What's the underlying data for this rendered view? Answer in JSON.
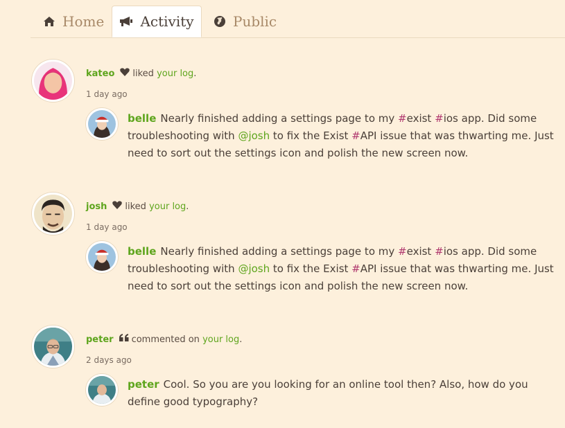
{
  "tabs": [
    {
      "label": "Home",
      "icon": "home-icon"
    },
    {
      "label": "Activity",
      "icon": "megaphone-icon"
    },
    {
      "label": "Public",
      "icon": "globe-icon"
    }
  ],
  "colors": {
    "accent_green": "#5ea51d",
    "hashtag": "#b0376e",
    "background": "#fdf0dc"
  },
  "feed": [
    {
      "user": "kateo",
      "action_icon": "heart-icon",
      "action": "liked",
      "link": "your log",
      "period": ".",
      "time": "1 day ago",
      "log": {
        "author": "belle",
        "p1": "Nearly finished adding a settings page to my ",
        "h1": "#",
        "t1": "exist",
        "s1": " ",
        "h2": "#",
        "t2": "ios",
        "p2": " app. Did some troubleshooting with ",
        "mention": "@josh",
        "p3": " to fix the Exist ",
        "h3": "#",
        "t3": "API",
        "p4": " issue that was thwarting me. Just need to sort out the settings icon and polish the new screen now."
      }
    },
    {
      "user": "josh",
      "action_icon": "heart-icon",
      "action": "liked",
      "link": "your log",
      "period": ".",
      "time": "1 day ago",
      "log": {
        "author": "belle",
        "p1": "Nearly finished adding a settings page to my ",
        "h1": "#",
        "t1": "exist",
        "s1": " ",
        "h2": "#",
        "t2": "ios",
        "p2": " app. Did some troubleshooting with ",
        "mention": "@josh",
        "p3": " to fix the Exist ",
        "h3": "#",
        "t3": "API",
        "p4": " issue that was thwarting me. Just need to sort out the settings icon and polish the new screen now."
      }
    },
    {
      "user": "peter",
      "action_icon": "quote-icon",
      "action": "commented on",
      "link": "your log",
      "period": ".",
      "time": "2 days ago",
      "comment": {
        "author": "peter",
        "text": "Cool. So you are you looking for an online tool then? Also, how do you define good typography?"
      }
    }
  ]
}
